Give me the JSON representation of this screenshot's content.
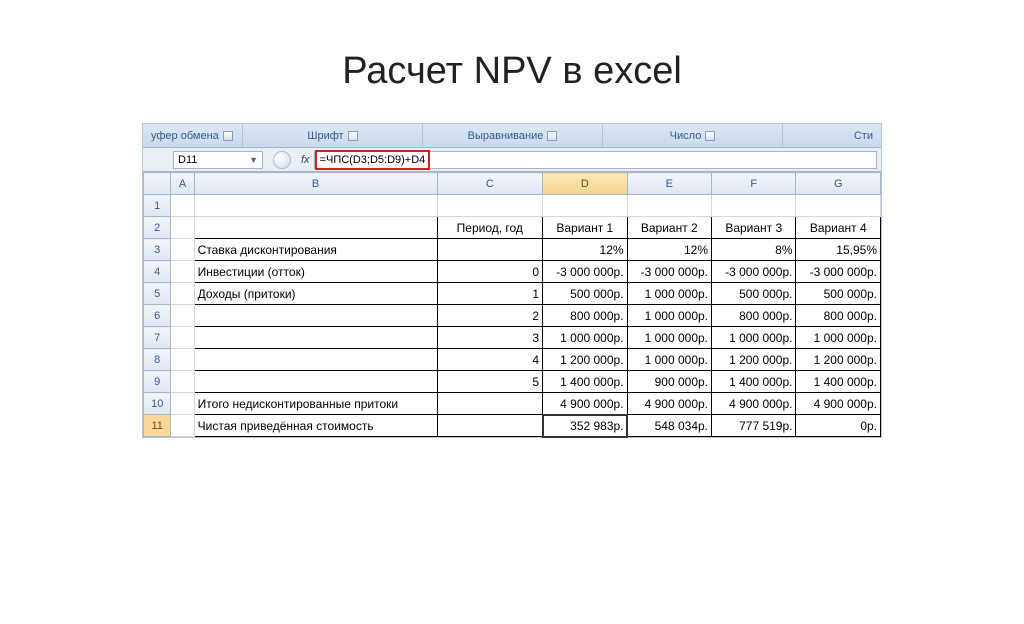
{
  "page": {
    "title": "Расчет NPV в excel"
  },
  "ribbon": {
    "groups": [
      "уфер обмена",
      "Шрифт",
      "Выравнивание",
      "Число",
      "Сти"
    ]
  },
  "formula_bar": {
    "name_box": "D11",
    "fx_label": "fx",
    "formula": "=ЧПС(D3;D5:D9)+D4"
  },
  "columns": [
    "A",
    "B",
    "C",
    "D",
    "E",
    "F",
    "G"
  ],
  "row_headers": [
    "1",
    "2",
    "3",
    "4",
    "5",
    "6",
    "7",
    "8",
    "9",
    "10",
    "11"
  ],
  "active_row": "11",
  "active_col": "D",
  "active_cell": "D11",
  "table": {
    "header_row": [
      "",
      "",
      "Период, год",
      "Вариант 1",
      "Вариант 2",
      "Вариант 3",
      "Вариант 4"
    ],
    "rows": [
      {
        "label": "Ставка дисконтирования",
        "period": "",
        "v": [
          "12%",
          "12%",
          "8%",
          "15,95%"
        ]
      },
      {
        "label": "Инвестиции (отток)",
        "period": "0",
        "v": [
          "-3 000 000р.",
          "-3 000 000р.",
          "-3 000 000р.",
          "-3 000 000р."
        ]
      },
      {
        "label": "Доходы (притоки)",
        "period": "1",
        "v": [
          "500 000р.",
          "1 000 000р.",
          "500 000р.",
          "500 000р."
        ]
      },
      {
        "label": "",
        "period": "2",
        "v": [
          "800 000р.",
          "1 000 000р.",
          "800 000р.",
          "800 000р."
        ]
      },
      {
        "label": "",
        "period": "3",
        "v": [
          "1 000 000р.",
          "1 000 000р.",
          "1 000 000р.",
          "1 000 000р."
        ]
      },
      {
        "label": "",
        "period": "4",
        "v": [
          "1 200 000р.",
          "1 000 000р.",
          "1 200 000р.",
          "1 200 000р."
        ]
      },
      {
        "label": "",
        "period": "5",
        "v": [
          "1 400 000р.",
          "900 000р.",
          "1 400 000р.",
          "1 400 000р."
        ]
      },
      {
        "label": "Итого недисконтированные притоки",
        "period": "",
        "v": [
          "4 900 000р.",
          "4 900 000р.",
          "4 900 000р.",
          "4 900 000р."
        ]
      },
      {
        "label": "Чистая приведённая стоимость",
        "period": "",
        "v": [
          "352 983р.",
          "548 034р.",
          "777 519р.",
          "0р."
        ]
      }
    ]
  },
  "chart_data": {
    "type": "table",
    "title": "Расчет NPV в excel",
    "columns": [
      "Период, год",
      "Вариант 1",
      "Вариант 2",
      "Вариант 3",
      "Вариант 4"
    ],
    "discount_rate": {
      "Вариант 1": 0.12,
      "Вариант 2": 0.12,
      "Вариант 3": 0.08,
      "Вариант 4": 0.1595
    },
    "investment_outflow": {
      "period": 0,
      "Вариант 1": -3000000,
      "Вариант 2": -3000000,
      "Вариант 3": -3000000,
      "Вариант 4": -3000000
    },
    "inflows": [
      {
        "period": 1,
        "Вариант 1": 500000,
        "Вариант 2": 1000000,
        "Вариант 3": 500000,
        "Вариант 4": 500000
      },
      {
        "period": 2,
        "Вариант 1": 800000,
        "Вариант 2": 1000000,
        "Вариант 3": 800000,
        "Вариант 4": 800000
      },
      {
        "period": 3,
        "Вариант 1": 1000000,
        "Вариант 2": 1000000,
        "Вариант 3": 1000000,
        "Вариант 4": 1000000
      },
      {
        "period": 4,
        "Вариант 1": 1200000,
        "Вариант 2": 1000000,
        "Вариант 3": 1200000,
        "Вариант 4": 1200000
      },
      {
        "period": 5,
        "Вариант 1": 1400000,
        "Вариант 2": 900000,
        "Вариант 3": 1400000,
        "Вариант 4": 1400000
      }
    ],
    "total_undiscounted_inflows": {
      "Вариант 1": 4900000,
      "Вариант 2": 4900000,
      "Вариант 3": 4900000,
      "Вариант 4": 4900000
    },
    "npv": {
      "Вариант 1": 352983,
      "Вариант 2": 548034,
      "Вариант 3": 777519,
      "Вариант 4": 0
    },
    "npv_formula_example": "=ЧПС(D3;D5:D9)+D4"
  }
}
